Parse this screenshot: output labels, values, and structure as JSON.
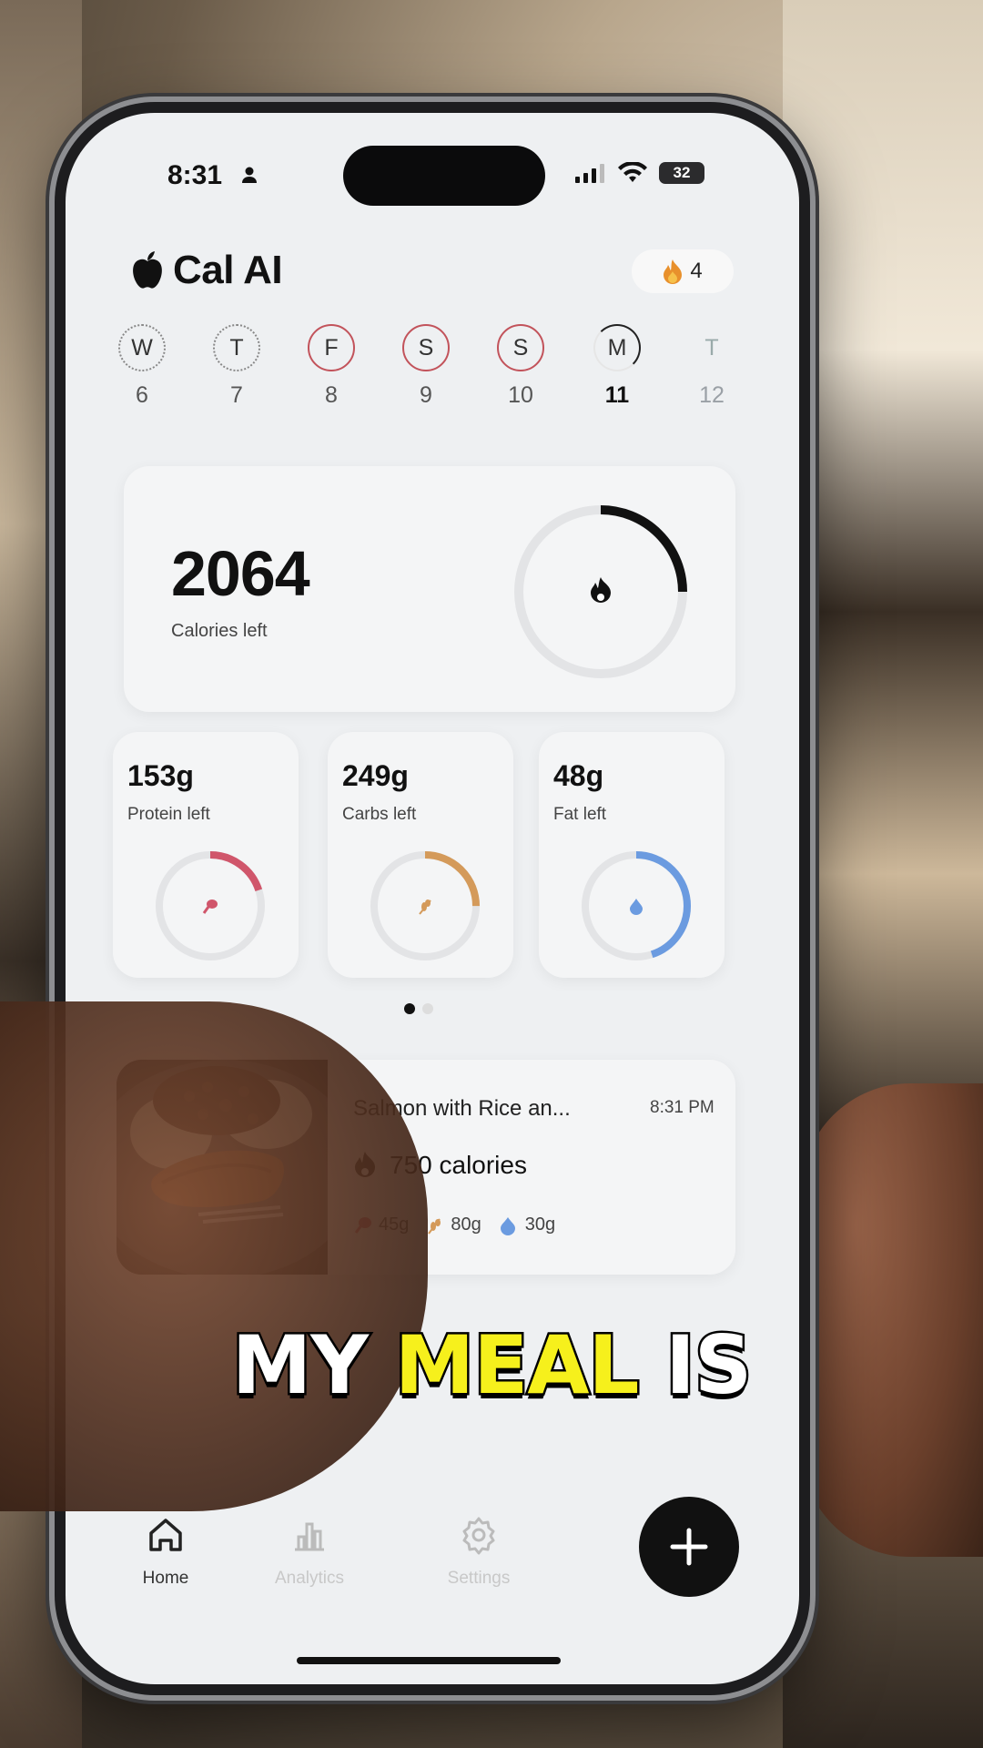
{
  "status_bar": {
    "time": "8:31",
    "battery": "32"
  },
  "app": {
    "title": "Cal AI",
    "streak": "4"
  },
  "days": [
    {
      "letter": "W",
      "num": "6",
      "ring": "dotted"
    },
    {
      "letter": "T",
      "num": "7",
      "ring": "dotted"
    },
    {
      "letter": "F",
      "num": "8",
      "ring": "red"
    },
    {
      "letter": "S",
      "num": "9",
      "ring": "red"
    },
    {
      "letter": "S",
      "num": "10",
      "ring": "red"
    },
    {
      "letter": "M",
      "num": "11",
      "ring": "partial",
      "today": true
    },
    {
      "letter": "T",
      "num": "12",
      "ring": "none",
      "future": true
    }
  ],
  "calories": {
    "value": "2064",
    "label": "Calories left",
    "progress": 0.25
  },
  "macros": [
    {
      "value": "153g",
      "label": "Protein left",
      "color": "#d0566b",
      "progress": 0.2,
      "icon": "drumstick-icon"
    },
    {
      "value": "249g",
      "label": "Carbs left",
      "color": "#d49a5a",
      "progress": 0.25,
      "icon": "wheat-icon"
    },
    {
      "value": "48g",
      "label": "Fat left",
      "color": "#6b9be0",
      "progress": 0.45,
      "icon": "drop-icon"
    }
  ],
  "meal": {
    "name": "Salmon with Rice an...",
    "time": "8:31 PM",
    "calories": "750 calories",
    "protein": "45g",
    "carbs": "80g",
    "fat": "30g"
  },
  "nav": {
    "home": "Home",
    "analytics": "Analytics",
    "settings": "Settings"
  },
  "caption": {
    "part1": "MY ",
    "highlight": "MEAL",
    "part2": " IS"
  }
}
